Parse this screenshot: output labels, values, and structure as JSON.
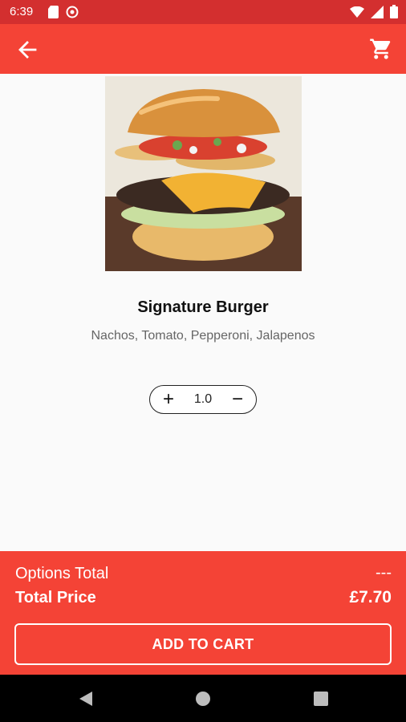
{
  "status_bar": {
    "time": "6:39",
    "icons_left": [
      "sd-card-icon",
      "sync-icon"
    ],
    "icons_right": [
      "wifi-icon",
      "signal-icon",
      "battery-icon"
    ]
  },
  "toolbar": {
    "back_icon": "arrow-left-icon",
    "cart_icon": "cart-icon",
    "background": "#f44336",
    "status_color": "#d32f2f"
  },
  "product": {
    "image_alt": "burger-photo",
    "title": "Signature Burger",
    "description": "Nachos, Tomato, Pepperoni, Jalapenos",
    "quantity": "1.0",
    "plus_label": "+",
    "minus_label": "−"
  },
  "summary": {
    "options_label": "Options Total",
    "options_value": "---",
    "total_label": "Total Price",
    "total_value": "£7.70",
    "add_to_cart": "ADD TO CART"
  },
  "nav": {
    "items": [
      "back-triangle-icon",
      "home-circle-icon",
      "recents-square-icon"
    ]
  }
}
